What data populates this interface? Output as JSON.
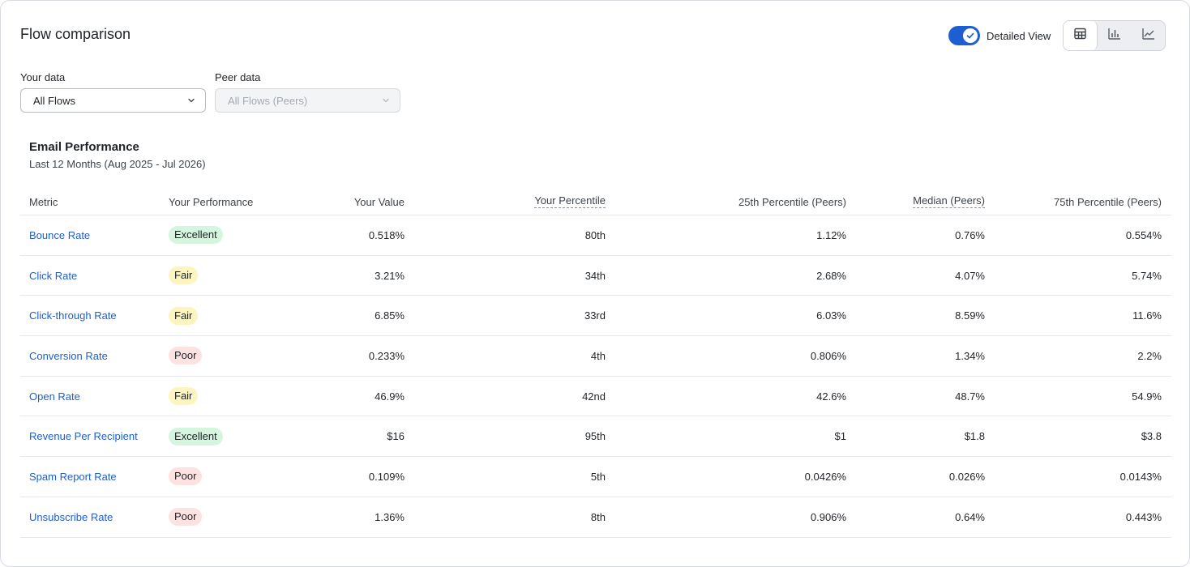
{
  "header": {
    "title": "Flow comparison",
    "toggle_label": "Detailed View",
    "toggle_on": true
  },
  "view_buttons": [
    {
      "icon": "table-icon",
      "active": true
    },
    {
      "icon": "bar-chart-icon",
      "active": false
    },
    {
      "icon": "line-chart-icon",
      "active": false
    }
  ],
  "filters": {
    "your_data": {
      "label": "Your data",
      "value": "All Flows"
    },
    "peer_data": {
      "label": "Peer data",
      "value": "All Flows (Peers)",
      "disabled": true
    }
  },
  "section": {
    "title": "Email Performance",
    "subtitle": "Last 12 Months (Aug 2025 - Jul 2026)"
  },
  "table": {
    "columns": {
      "metric": "Metric",
      "performance": "Your Performance",
      "value": "Your Value",
      "percentile": "Your Percentile",
      "p25": "25th Percentile (Peers)",
      "median": "Median (Peers)",
      "p75": "75th Percentile (Peers)"
    },
    "rows": [
      {
        "metric": "Bounce Rate",
        "performance": "Excellent",
        "value": "0.518%",
        "percentile": "80th",
        "p25": "1.12%",
        "median": "0.76%",
        "p75": "0.554%"
      },
      {
        "metric": "Click Rate",
        "performance": "Fair",
        "value": "3.21%",
        "percentile": "34th",
        "p25": "2.68%",
        "median": "4.07%",
        "p75": "5.74%"
      },
      {
        "metric": "Click-through Rate",
        "performance": "Fair",
        "value": "6.85%",
        "percentile": "33rd",
        "p25": "6.03%",
        "median": "8.59%",
        "p75": "11.6%"
      },
      {
        "metric": "Conversion Rate",
        "performance": "Poor",
        "value": "0.233%",
        "percentile": "4th",
        "p25": "0.806%",
        "median": "1.34%",
        "p75": "2.2%"
      },
      {
        "metric": "Open Rate",
        "performance": "Fair",
        "value": "46.9%",
        "percentile": "42nd",
        "p25": "42.6%",
        "median": "48.7%",
        "p75": "54.9%"
      },
      {
        "metric": "Revenue Per Recipient",
        "performance": "Excellent",
        "value": "$16",
        "percentile": "95th",
        "p25": "$1",
        "median": "$1.8",
        "p75": "$3.8"
      },
      {
        "metric": "Spam Report Rate",
        "performance": "Poor",
        "value": "0.109%",
        "percentile": "5th",
        "p25": "0.0426%",
        "median": "0.026%",
        "p75": "0.0143%"
      },
      {
        "metric": "Unsubscribe Rate",
        "performance": "Poor",
        "value": "1.36%",
        "percentile": "8th",
        "p25": "0.906%",
        "median": "0.64%",
        "p75": "0.443%"
      }
    ]
  },
  "colors": {
    "accent": "#1d5fd1",
    "excellent_bg": "#d6f5df",
    "fair_bg": "#fdf5bf",
    "poor_bg": "#fde2e2"
  }
}
